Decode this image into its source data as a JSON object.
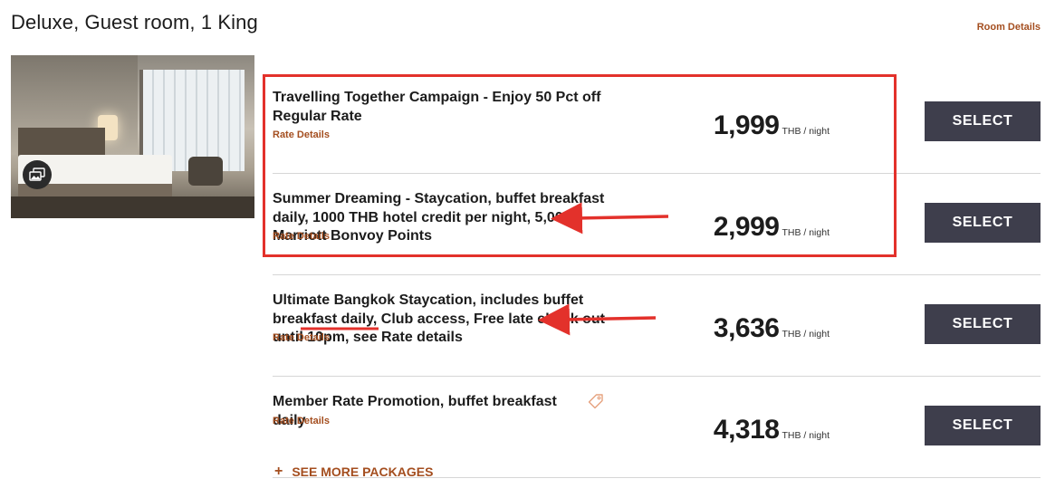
{
  "room": {
    "title": "Deluxe, Guest room, 1 King",
    "details_link": "Room Details"
  },
  "photo": {
    "gallery_icon": "photo-gallery-icon"
  },
  "rates": [
    {
      "name": "Travelling Together Campaign - Enjoy 50 Pct off Regular Rate",
      "details_label": "Rate Details",
      "price": "1,999",
      "unit": "THB / night",
      "select_label": "SELECT",
      "highlighted": true
    },
    {
      "name": "Summer Dreaming - Staycation, buffet breakfast daily, 1000 THB hotel credit per night, 5,000 Marriott Bonvoy Points",
      "details_label": "Rate Details",
      "price": "2,999",
      "unit": "THB / night",
      "select_label": "SELECT",
      "highlighted": true,
      "arrow_annotation": true
    },
    {
      "name": "Ultimate Bangkok Staycation, includes buffet breakfast daily, Club access, Free late check out until 10pm, see Rate details",
      "details_label": "Rate Details",
      "price": "3,636",
      "unit": "THB / night",
      "select_label": "SELECT",
      "arrow_annotation": true,
      "underlined_text": "until 10pm"
    },
    {
      "name": "Member Rate Promotion, buffet breakfast daily",
      "details_label": "Rate Details",
      "price": "4,318",
      "unit": "THB / night",
      "select_label": "SELECT",
      "icon": "tag-icon"
    }
  ],
  "see_more": {
    "icon": "plus-icon",
    "label": "SEE MORE PACKAGES"
  },
  "colors": {
    "accent": "#a44e1f",
    "button_bg": "#3e3e4c",
    "annotation_red": "#e3312b",
    "divider": "#d6d6d6"
  }
}
